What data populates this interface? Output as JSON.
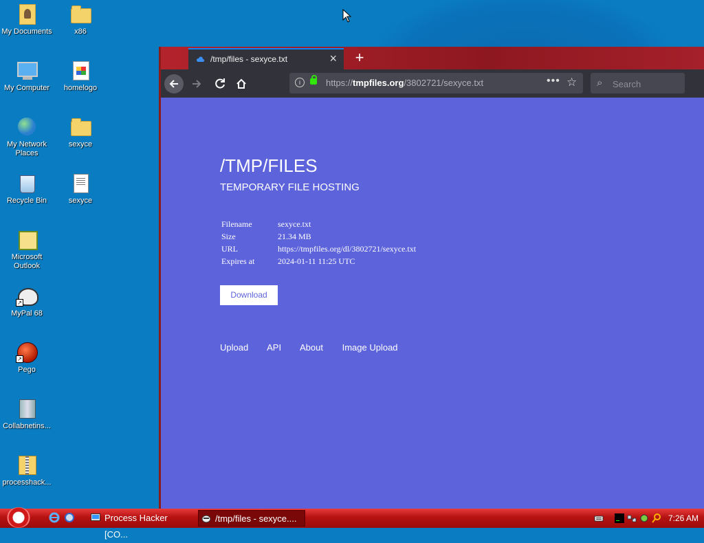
{
  "desktop": {
    "icons": [
      {
        "label": "My Documents",
        "icon": "my-documents-icon"
      },
      {
        "label": "x86",
        "icon": "folder-icon"
      },
      {
        "label": "My Computer",
        "icon": "computer-icon"
      },
      {
        "label": "homelogo",
        "icon": "image-file-icon"
      },
      {
        "label": "My Network Places",
        "icon": "network-icon"
      },
      {
        "label": "sexyce",
        "icon": "folder-icon"
      },
      {
        "label": "Recycle Bin",
        "icon": "recycle-bin-icon"
      },
      {
        "label": "sexyce",
        "icon": "text-file-icon"
      },
      {
        "label": "Microsoft Outlook",
        "icon": "outlook-icon"
      },
      {
        "label": "MyPal 68",
        "icon": "mypal-browser-icon"
      },
      {
        "label": "Pego",
        "icon": "pego-icon"
      },
      {
        "label": "Collabnetins...",
        "icon": "installer-icon"
      },
      {
        "label": "processhack...",
        "icon": "zip-folder-icon"
      }
    ]
  },
  "browser": {
    "tab_title": "/tmp/files - sexyce.txt",
    "url_prefix": "https://",
    "url_domain": "tmpfiles.org",
    "url_path": "/3802721/sexyce.txt",
    "search_placeholder": "Search"
  },
  "page": {
    "title": "/TMP/FILES",
    "subtitle": "TEMPORARY FILE HOSTING",
    "meta": [
      {
        "key": "Filename",
        "value": "sexyce.txt"
      },
      {
        "key": "Size",
        "value": "21.34 MB"
      },
      {
        "key": "URL",
        "value": "https://tmpfiles.org/dl/3802721/sexyce.txt"
      },
      {
        "key": "Expires at",
        "value": "2024-01-11 11:25 UTC"
      }
    ],
    "download_label": "Download",
    "footer_links": [
      "Upload",
      "API",
      "About",
      "Image Upload"
    ]
  },
  "taskbar": {
    "buttons": [
      {
        "label": "Process Hacker [CO...",
        "icon": "process-hacker-icon"
      },
      {
        "label": "/tmp/files - sexyce....",
        "icon": "mypal-browser-icon",
        "active": true
      }
    ],
    "clock": "7:26 AM"
  },
  "colors": {
    "page_bg": "#5d63db",
    "desktop_bg": "#0a7dc2",
    "taskbar_red": "#b51212",
    "lock_green": "#30e60b"
  }
}
